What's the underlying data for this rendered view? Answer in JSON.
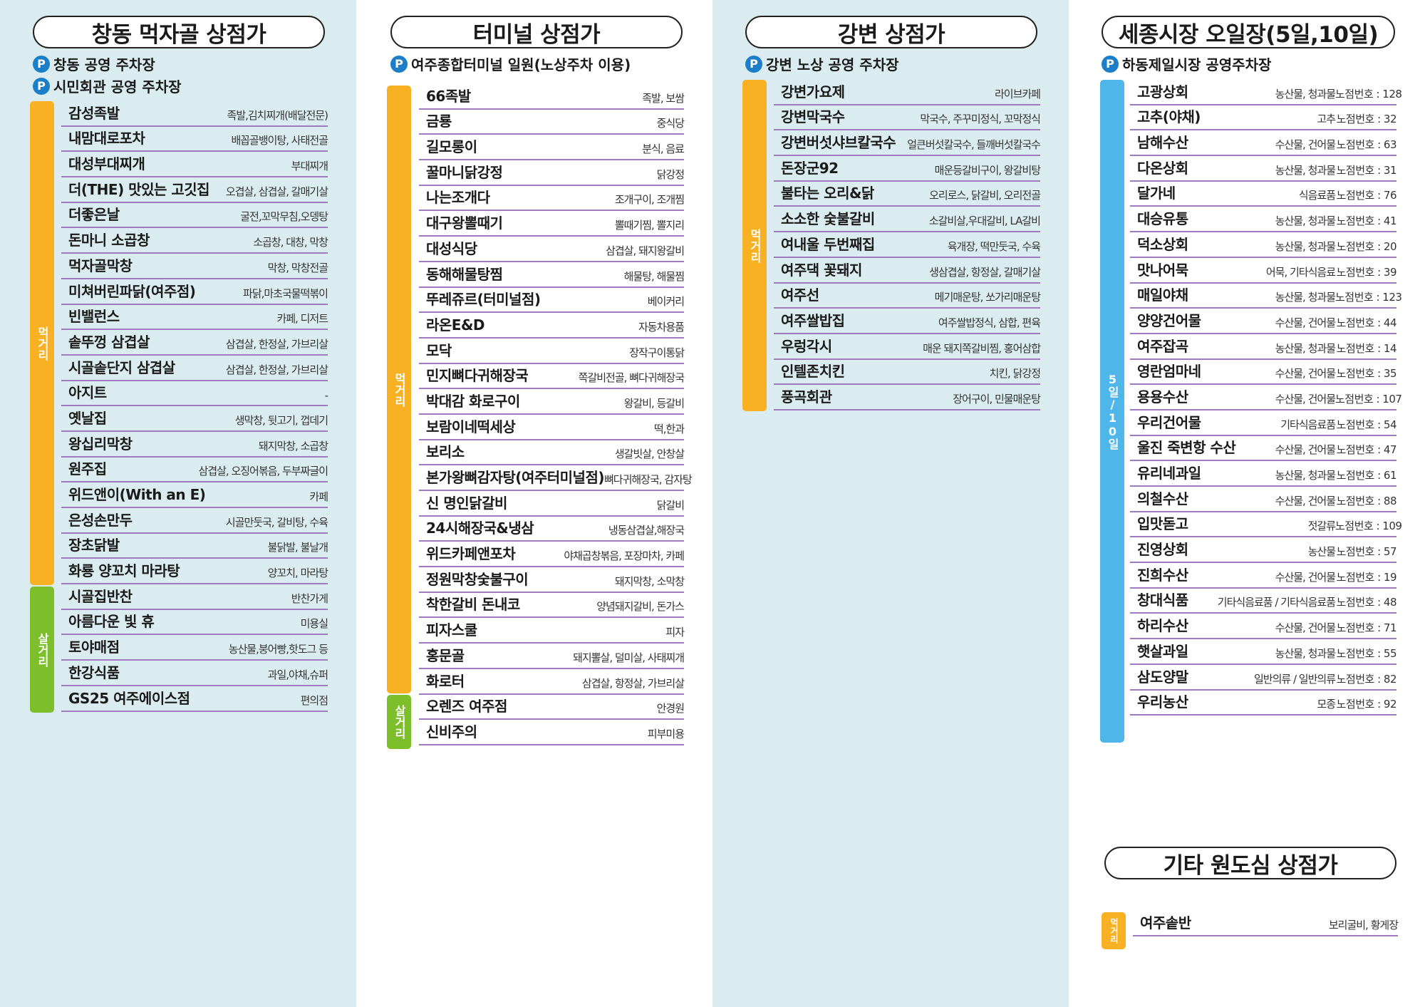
{
  "p1": {
    "title": "창동 먹자골 상점가",
    "parking": [
      "창동 공영 주차장",
      "시민회관 공영 주차장"
    ],
    "parking_badge": "P",
    "cat_food": "먹거리",
    "cat_goods": "살거리",
    "food": [
      {
        "name": "감성족발",
        "desc": "족발,김치찌개(배달전문)"
      },
      {
        "name": "내맘대로포차",
        "desc": "배꼽골뱅이탕, 사태전골"
      },
      {
        "name": "대성부대찌개",
        "desc": "부대찌개"
      },
      {
        "name": "더(THE) 맛있는 고깃집",
        "desc": "오겹살, 삼겹살, 갈매기살"
      },
      {
        "name": "더좋은날",
        "desc": "굴전,꼬막무침,오뎅탕"
      },
      {
        "name": "돈마니 소곱창",
        "desc": "소곱창, 대창, 막창"
      },
      {
        "name": "먹자골막창",
        "desc": "막창, 막창전골"
      },
      {
        "name": "미쳐버린파닭(여주점)",
        "desc": "파닭,마초국물떡볶이"
      },
      {
        "name": "빈밸런스",
        "desc": "카페, 디저트"
      },
      {
        "name": "솥뚜껑 삼겹살",
        "desc": "삼겹살, 한정살, 가브리살"
      },
      {
        "name": "시골솥단지 삼겹살",
        "desc": "삼겹살, 한정살, 가브리살"
      },
      {
        "name": "아지트",
        "desc": "-"
      },
      {
        "name": "옛날집",
        "desc": "생막창, 뒷고기, 껍데기"
      },
      {
        "name": "왕십리막창",
        "desc": "돼지막창, 소곱창"
      },
      {
        "name": "원주집",
        "desc": "삼겹살, 오징어볶음, 두부짜글이"
      },
      {
        "name": "위드앤이(With an E)",
        "desc": "카페"
      },
      {
        "name": "은성손만두",
        "desc": "시골만둣국, 갈비탕, 수육"
      },
      {
        "name": "장초닭발",
        "desc": "불닭발, 불날개"
      },
      {
        "name": "화룡 양꼬치 마라탕",
        "desc": "양꼬치, 마라탕"
      }
    ],
    "goods": [
      {
        "name": "시골집반찬",
        "desc": "반찬가게"
      },
      {
        "name": "아름다운 빛 휴",
        "desc": "미용실"
      },
      {
        "name": "토야매점",
        "desc": "농산물,붕어빵,핫도그 등"
      },
      {
        "name": "한강식품",
        "desc": "과일,야채,슈퍼"
      },
      {
        "name": "GS25 여주에이스점",
        "desc": "편의점"
      }
    ]
  },
  "p2": {
    "title": "터미널 상점가",
    "parking": [
      "여주종합터미널 일원(노상주차 이용)"
    ],
    "parking_badge": "P",
    "cat_food": "먹거리",
    "cat_goods": "살거리",
    "food": [
      {
        "name": "66족발",
        "desc": "족발, 보쌈"
      },
      {
        "name": "금룡",
        "desc": "중식당"
      },
      {
        "name": "길모롱이",
        "desc": "분식, 음료"
      },
      {
        "name": "꿀마니닭강정",
        "desc": "닭강정"
      },
      {
        "name": "나는조개다",
        "desc": "조개구이, 조개찜"
      },
      {
        "name": "대구왕뽈때기",
        "desc": "뽈때기찜, 뽈지리"
      },
      {
        "name": "대성식당",
        "desc": "삼겹살, 돼지왕갈비"
      },
      {
        "name": "동해해물탕찜",
        "desc": "해물탕, 해물찜"
      },
      {
        "name": "뚜레쥬르(터미널점)",
        "desc": "베이커리"
      },
      {
        "name": "라온E&D",
        "desc": "자동차용품"
      },
      {
        "name": "모닥",
        "desc": "장작구이통닭"
      },
      {
        "name": "민지뼈다귀해장국",
        "desc": "쪽갈비전골, 뼈다귀해장국"
      },
      {
        "name": "박대감 화로구이",
        "desc": "왕갈비, 등갈비"
      },
      {
        "name": "보람이네떡세상",
        "desc": "떡,한과"
      },
      {
        "name": "보리소",
        "desc": "생갈빗살, 안창살"
      },
      {
        "name": "본가왕뼈감자탕(여주터미널점)",
        "desc": "뼈다귀해장국, 감자탕"
      },
      {
        "name": "신 명인닭갈비",
        "desc": "닭갈비"
      },
      {
        "name": "24시해장국&냉삼",
        "desc": "냉동삼겹살,해장국"
      },
      {
        "name": "위드카페앤포차",
        "desc": "야채곱창볶음, 포장마차, 카페"
      },
      {
        "name": "정원막창숯불구이",
        "desc": "돼지막창, 소막창"
      },
      {
        "name": "착한갈비 돈내코",
        "desc": "양념돼지갈비, 돈가스"
      },
      {
        "name": "피자스쿨",
        "desc": "피자"
      },
      {
        "name": "홍문골",
        "desc": "돼지뽈살, 덜미살, 사태찌개"
      },
      {
        "name": "화로터",
        "desc": "삼겹살, 항정살, 가브리살"
      }
    ],
    "goods": [
      {
        "name": "오렌즈 여주점",
        "desc": "안경원"
      },
      {
        "name": "신비주의",
        "desc": "피부미용"
      }
    ]
  },
  "p3": {
    "title": "강변 상점가",
    "parking": [
      "강변 노상 공영 주차장"
    ],
    "parking_badge": "P",
    "cat_food": "먹거리",
    "food": [
      {
        "name": "강변가요제",
        "desc": "라이브카페"
      },
      {
        "name": "강변막국수",
        "desc": "막국수, 주꾸미정식, 꼬막정식"
      },
      {
        "name": "강변버섯샤브칼국수",
        "desc": "얼큰버섯칼국수, 들깨버섯칼국수"
      },
      {
        "name": "돈장군92",
        "desc": "매운등갈비구이, 왕갈비탕"
      },
      {
        "name": "불타는 오리&닭",
        "desc": "오리로스, 닭갈비, 오리전골"
      },
      {
        "name": "소소한 숯불갈비",
        "desc": "소갈비살,우대갈비, LA갈비"
      },
      {
        "name": "여내울 두번째집",
        "desc": "육개장, 떡만둣국, 수육"
      },
      {
        "name": "여주댁 꽃돼지",
        "desc": "생삼겹살, 항정살, 갈매기살"
      },
      {
        "name": "여주선",
        "desc": "메기매운탕, 쏘가리매운탕"
      },
      {
        "name": "여주쌀밥집",
        "desc": "여주쌀밥정식, 삼합, 편육"
      },
      {
        "name": "우렁각시",
        "desc": "매운 돼지쪽갈비찜, 홍어삼합"
      },
      {
        "name": "인텔존치킨",
        "desc": "치킨, 닭강정"
      },
      {
        "name": "풍곡회관",
        "desc": "장어구이, 민물매운탕"
      }
    ]
  },
  "p4": {
    "title": "세종시장 오일장(5일,10일)",
    "parking": [
      "하동제일시장 공영주차장"
    ],
    "parking_badge": "P",
    "cat": "5일/10일",
    "items": [
      {
        "name": "고광상회",
        "desc": "농산물, 청과물",
        "no": "노점번호 : 128"
      },
      {
        "name": "고추(야채)",
        "desc": "고추",
        "no": "노점번호 : 32"
      },
      {
        "name": "남해수산",
        "desc": "수산물, 건어물",
        "no": "노점번호 : 63"
      },
      {
        "name": "다온상회",
        "desc": "농산물, 청과물",
        "no": "노점번호 : 31"
      },
      {
        "name": "달가네",
        "desc": "식음료품",
        "no": "노점번호 : 76"
      },
      {
        "name": "대승유통",
        "desc": "농산물, 청과물",
        "no": "노점번호 : 41"
      },
      {
        "name": "덕소상회",
        "desc": "농산물, 청과물",
        "no": "노점번호 : 20"
      },
      {
        "name": "맛나어묵",
        "desc": "어묵, 기타식음료",
        "no": "노점번호 : 39"
      },
      {
        "name": "매일야채",
        "desc": "농산물, 청과물",
        "no": "노점번호 : 123"
      },
      {
        "name": "양양건어물",
        "desc": "수산물, 건어물",
        "no": "노점번호 : 44"
      },
      {
        "name": "여주잡곡",
        "desc": "농산물, 청과물",
        "no": "노점번호 : 14"
      },
      {
        "name": "영란엄마네",
        "desc": "수산물, 건어물",
        "no": "노점번호 : 35"
      },
      {
        "name": "용용수산",
        "desc": "수산물, 건어물",
        "no": "노점번호 : 107"
      },
      {
        "name": "우리건어물",
        "desc": "기타식음료품",
        "no": "노점번호 : 54"
      },
      {
        "name": "울진 죽변항 수산",
        "desc": "수산물, 건어물",
        "no": "노점번호 : 47"
      },
      {
        "name": "유리네과일",
        "desc": "농산물, 청과물",
        "no": "노점번호 : 61"
      },
      {
        "name": "의철수산",
        "desc": "수산물, 건어물",
        "no": "노점번호 : 88"
      },
      {
        "name": "입맛돋고",
        "desc": "젓갈류",
        "no": "노점번호 : 109"
      },
      {
        "name": "진영상회",
        "desc": "농산물",
        "no": "노점번호 : 57"
      },
      {
        "name": "진희수산",
        "desc": "수산물, 건어물",
        "no": "노점번호 : 19"
      },
      {
        "name": "창대식품",
        "desc": "기타식음료품 / 기타식음료품",
        "no": "노점번호 : 48"
      },
      {
        "name": "하리수산",
        "desc": "수산물, 건어물",
        "no": "노점번호 : 71"
      },
      {
        "name": "햇살과일",
        "desc": "농산물, 청과물",
        "no": "노점번호 : 55"
      },
      {
        "name": "삼도양말",
        "desc": "일반의류 / 일반의류",
        "no": "노점번호 : 82"
      },
      {
        "name": "우리농산",
        "desc": "모종",
        "no": "노점번호 : 92"
      }
    ]
  },
  "p5": {
    "title": "기타 원도심 상점가",
    "cat_food": "먹거리",
    "food": [
      {
        "name": "여주솥반",
        "desc": "보리굴비, 황게장"
      }
    ]
  }
}
